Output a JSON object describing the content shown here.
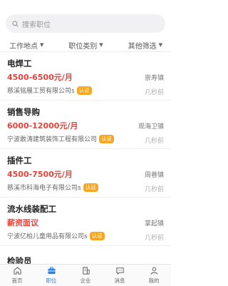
{
  "search": {
    "placeholder": "搜索职位"
  },
  "filters": [
    {
      "label": "工作地点"
    },
    {
      "label": "职位类别"
    },
    {
      "label": "其他筛选"
    }
  ],
  "jobs": [
    {
      "title": "电焊工",
      "salary": "4500-6500元/月",
      "location": "崇寿镇",
      "company": "慈溪铭展工贸有限公司s",
      "badge": "认证",
      "time": "几秒前"
    },
    {
      "title": "销售导购",
      "salary": "6000-12000元/月",
      "location": "观海卫镇",
      "company": "宁波敢涛建筑装饰工程有限公司",
      "badge": "认证",
      "time": "几秒前"
    },
    {
      "title": "插件工",
      "salary": "4500-7500元/月",
      "location": "周巷镇",
      "company": "慈溪市科海电子有限公司s",
      "badge": "认证",
      "time": "几秒前"
    },
    {
      "title": "流水线装配工",
      "salary": "薪资面议",
      "location": "掌起镇",
      "company": "宁波亿柏儿童用品有限公司s",
      "badge": "认证",
      "time": "几秒前"
    }
  ],
  "partial_job": {
    "title": "检验员"
  },
  "tabbar": {
    "active_color": "#2a7fe8",
    "tabs": [
      {
        "label": "首页",
        "icon": "home-icon"
      },
      {
        "label": "职位",
        "icon": "briefcase-icon"
      },
      {
        "label": "企业",
        "icon": "building-icon"
      },
      {
        "label": "消息",
        "icon": "message-icon"
      },
      {
        "label": "我的",
        "icon": "user-icon"
      }
    ]
  }
}
